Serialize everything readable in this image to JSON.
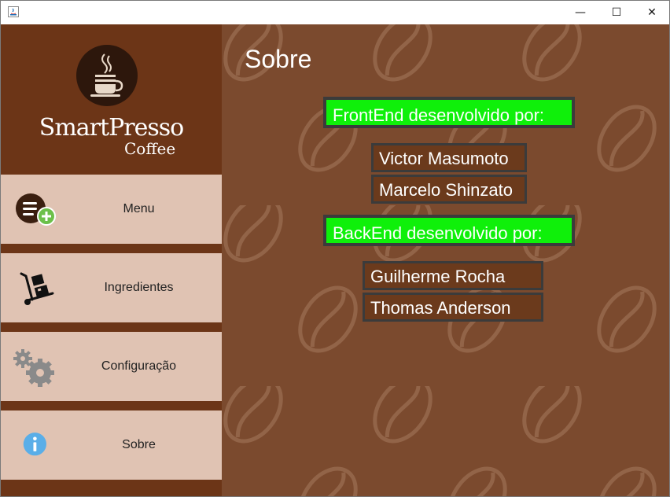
{
  "window": {
    "min_glyph": "—",
    "max_glyph": "☐",
    "close_glyph": "✕"
  },
  "logo": {
    "title": "SmartPresso",
    "subtitle": "Coffee"
  },
  "sidebar": {
    "items": [
      {
        "label": "Menu",
        "icon": "menu-add-icon"
      },
      {
        "label": "Ingredientes",
        "icon": "hand-truck-icon"
      },
      {
        "label": "Configuração",
        "icon": "gears-icon"
      },
      {
        "label": "Sobre",
        "icon": "info-icon"
      }
    ]
  },
  "main": {
    "title": "Sobre",
    "frontend": {
      "heading": "FrontEnd desenvolvido por:",
      "names": [
        "Victor Masumoto",
        "Marcelo Shinzato"
      ]
    },
    "backend": {
      "heading": "BackEnd desenvolvido por:",
      "names": [
        "Guilherme Rocha",
        "Thomas Anderson"
      ]
    }
  },
  "colors": {
    "sidebar_bg": "#6c3517",
    "nav_item_bg": "#e0c3b3",
    "content_bg": "#7b4a2e",
    "heading_bg": "#0ff00a",
    "name_bg": "#6b3a1c"
  }
}
